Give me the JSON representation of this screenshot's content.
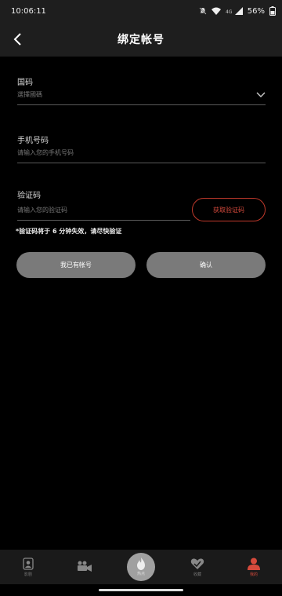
{
  "status_bar": {
    "time": "10:06:11",
    "battery": "56%"
  },
  "header": {
    "title": "绑定帐号"
  },
  "form": {
    "country": {
      "label": "国码",
      "placeholder": "選擇國碼"
    },
    "phone": {
      "label": "手机号码",
      "placeholder": "请输入您的手机号码"
    },
    "code": {
      "label": "验证码",
      "placeholder": "请输入您的验证码",
      "button": "获取验证码"
    },
    "notice": "*验证码将于 6 分钟失效，请尽快验证"
  },
  "actions": {
    "have_account": "我已有帐号",
    "confirm": "确认"
  },
  "tabs": [
    {
      "label": "影剧",
      "icon": "portrait-icon"
    },
    {
      "label": "",
      "icon": "video-camera-icon"
    },
    {
      "label": "热点",
      "icon": "flame-icon"
    },
    {
      "label": "收藏",
      "icon": "heart-check-icon"
    },
    {
      "label": "我的",
      "icon": "user-icon"
    }
  ],
  "colors": {
    "accent": "#d64a3c",
    "button_gray": "#7a7a7a",
    "bar": "#1e1e1e"
  }
}
